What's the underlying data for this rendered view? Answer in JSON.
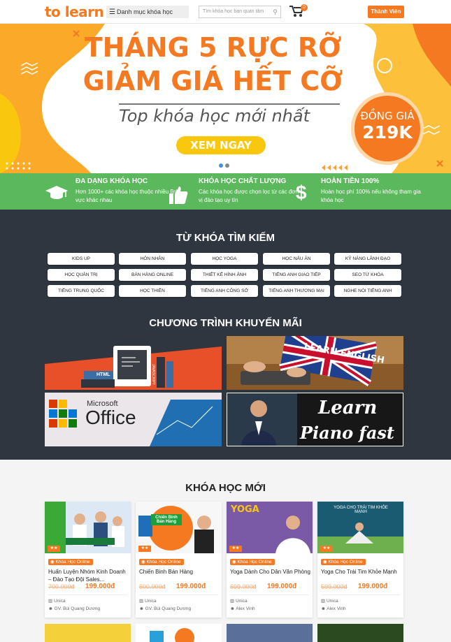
{
  "header": {
    "logo": "to learn",
    "category_label": "Danh mục khóa học",
    "search_placeholder": "Tìm khóa học bạn quan tâm",
    "cart_count": "0",
    "member_button": "Thành Viên"
  },
  "banner": {
    "title_line1": "THÁNG 5 RỰC RỠ",
    "title_line2": "GIẢM GIÁ HẾT CỠ",
    "subtitle": "Top khóa học mới nhất",
    "cta": "XEM NGAY",
    "price_label": "ĐỒNG GIÁ",
    "price_value": "219K"
  },
  "features": [
    {
      "title": "ĐA DẠNG KHÓA HỌC",
      "desc": "Hơn 1000+ các khóa học thuộc nhiều lĩnh vực khác nhau",
      "icon": "graduation-cap-icon"
    },
    {
      "title": "KHÓA HỌC CHẤT LƯỢNG",
      "desc": "Các khóa học được chọn lọc từ các đơn vị đào tạo uy tín",
      "icon": "thumbs-up-icon"
    },
    {
      "title": "HOÀN TIỀN 100%",
      "desc": "Hoàn học phí 100% nếu không tham gia khóa học",
      "icon": "dollar-icon"
    }
  ],
  "keywords": {
    "title": "TỪ KHÓA TÌM KIẾM",
    "items": [
      "KIDS UP",
      "HÔN NHÂN",
      "HỌC YOGA",
      "HỌC NẤU ĂN",
      "KỸ NĂNG LÃNH ĐẠO",
      "HỌC QUẢN TRỊ",
      "BÁN HÀNG ONLINE",
      "THIẾT KẾ HÌNH ẢNH",
      "TIẾNG ANH GIAO TIẾP",
      "SEO TỪ KHÓA",
      "TIẾNG TRUNG QUỐC",
      "HỌC THIỀN",
      "TIẾNG ANH CÔNG SỞ",
      "TIẾNG ANH THƯƠNG MẠI",
      "NGHE NÓI TIẾNG ANH"
    ]
  },
  "promotions": {
    "title": "CHƯƠNG TRÌNH KHUYẾN MÃI",
    "items": [
      {
        "label": "HTML",
        "label2": "JAVASCRIPT"
      },
      {
        "label": "LEARN ENGLISH"
      },
      {
        "label": "Microsoft",
        "label2": "Office"
      },
      {
        "label": "Learn",
        "label2": "Piano fast"
      }
    ]
  },
  "new_courses": {
    "title": "KHÓA HỌC MỚI",
    "tag": "Khóa Học Online",
    "items": [
      {
        "title": "Huấn Luyện Nhóm Kinh Doanh – Đào Tạo Đội Sales...",
        "old_price": "700.000đ",
        "price": "199.000đ",
        "provider": "Unica",
        "author": "GV. Bùi Quang Dương",
        "stars": "★★"
      },
      {
        "title": "Chiến Binh Bán Hàng",
        "old_price": "500.000đ",
        "price": "199.000đ",
        "provider": "Unica",
        "author": "GV. Bùi Quang Dương",
        "stars": "★★",
        "thumb_text": "Chiến Binh Bán Hàng"
      },
      {
        "title": "Yoga Dành Cho Dân Văn Phòng",
        "old_price": "699.000đ",
        "price": "199.000đ",
        "provider": "Unica",
        "author": "Alex Vinh",
        "stars": "★★",
        "thumb_text": "YOGA"
      },
      {
        "title": "Yoga Cho Trái Tim Khỏe Mạnh",
        "old_price": "599.000đ",
        "price": "199.000đ",
        "provider": "Unica",
        "author": "Alex Vinh",
        "stars": "★★",
        "thumb_text": "YOGA CHO TRÁI TIM KHỎE MẠNH"
      }
    ]
  },
  "colors": {
    "accent": "#f47920",
    "green": "#5cb85c",
    "dark": "#2f3640"
  }
}
